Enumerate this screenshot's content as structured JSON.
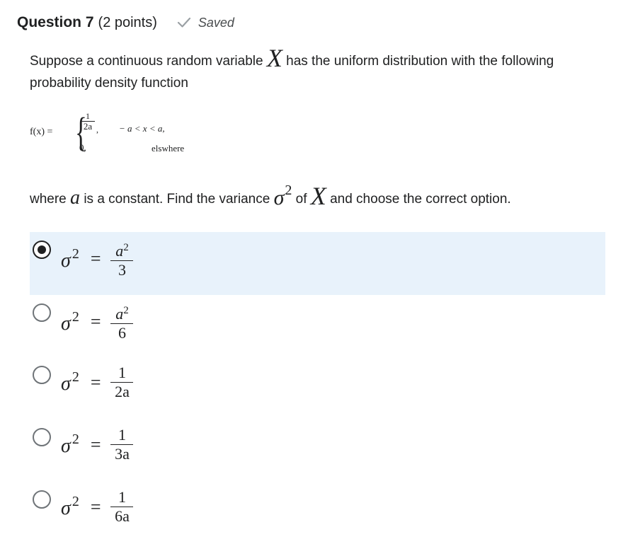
{
  "question": {
    "title": "Question 7",
    "points": "(2 points)",
    "status": "Saved"
  },
  "stem": {
    "line_before_x": "Suppose a continuous random variable",
    "var_x": "X",
    "line_after_x": "has the uniform distribution with the following probability density function"
  },
  "pdf": {
    "fx": "f(x) =",
    "case1_num": "1",
    "case1_den": "2a",
    "case1_cond": "− a < x < a,",
    "case2_val": "0,",
    "case2_cond": "elswhere"
  },
  "where_line": {
    "part1": "where",
    "var_a": "a",
    "part2": "is a constant. Find the variance",
    "sigma": "σ",
    "sigma_exp": "2",
    "part3": "of",
    "var_x": "X",
    "part4": "and choose the correct option."
  },
  "options": [
    {
      "sigma": "σ",
      "exp": "2",
      "eq": "=",
      "num": "a",
      "num_exp": "2",
      "den": "3",
      "selected": true
    },
    {
      "sigma": "σ",
      "exp": "2",
      "eq": "=",
      "num": "a",
      "num_exp": "2",
      "den": "6",
      "selected": false
    },
    {
      "sigma": "σ",
      "exp": "2",
      "eq": "=",
      "num": "1",
      "num_exp": "",
      "den": "2a",
      "selected": false
    },
    {
      "sigma": "σ",
      "exp": "2",
      "eq": "=",
      "num": "1",
      "num_exp": "",
      "den": "3a",
      "selected": false
    },
    {
      "sigma": "σ",
      "exp": "2",
      "eq": "=",
      "num": "1",
      "num_exp": "",
      "den": "6a",
      "selected": false
    }
  ],
  "colors": {
    "selected_bg": "#e8f2fb",
    "text": "#202122",
    "check": "#9aa0a4"
  },
  "icons": {
    "saved": "check-icon",
    "radio_selected": "radio-selected-icon",
    "radio_empty": "radio-empty-icon"
  }
}
